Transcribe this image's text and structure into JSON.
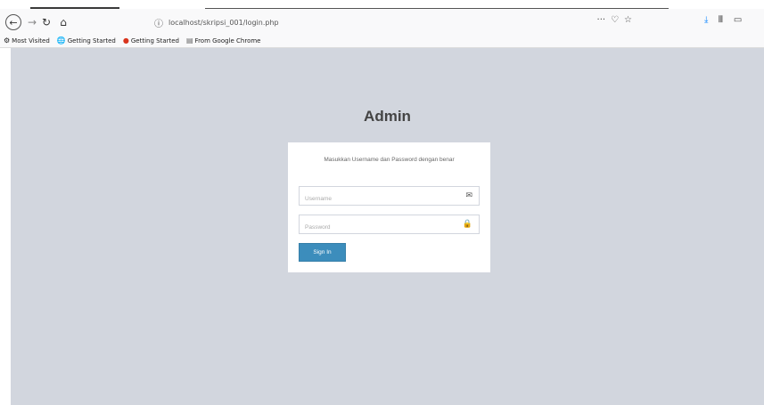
{
  "browser": {
    "url": "localhost/skripsi_001/login.php",
    "url_actions": [
      "···",
      "♡",
      "☆"
    ],
    "bookmarks": [
      {
        "label": "Most Visited",
        "icon": "gear-icon"
      },
      {
        "label": "Getting Started",
        "icon": "globe-icon"
      },
      {
        "label": "Getting Started",
        "icon": "firefox-icon"
      },
      {
        "label": "From Google Chrome",
        "icon": "folder-icon"
      }
    ]
  },
  "page": {
    "logo": "Admin",
    "message": "Masukkan Username dan Password dengan benar",
    "username_placeholder": "Username",
    "password_placeholder": "Password",
    "signin_label": "Sign In"
  },
  "colors": {
    "page_bg": "#d2d6de",
    "button": "#3c8dbc"
  }
}
